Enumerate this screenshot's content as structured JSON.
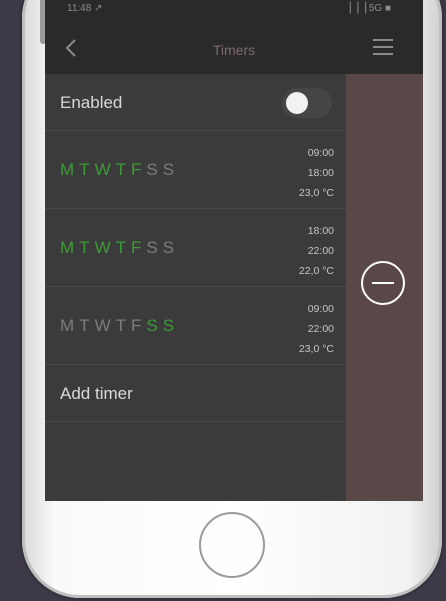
{
  "status_bar": {
    "time": "11:48 ↗",
    "signal": "▕▕▕ 5G ■"
  },
  "navbar": {
    "back_icon": "chevron-left-icon",
    "title": "Timers",
    "menu_icon": "hamburger-menu-icon"
  },
  "enabled_row": {
    "label": "Enabled",
    "toggle_on": false
  },
  "timers": [
    {
      "days": [
        {
          "letter": "M",
          "active": true
        },
        {
          "letter": "T",
          "active": true
        },
        {
          "letter": "W",
          "active": true
        },
        {
          "letter": "T",
          "active": true
        },
        {
          "letter": "F",
          "active": true
        },
        {
          "letter": "S",
          "active": false
        },
        {
          "letter": "S",
          "active": false
        }
      ],
      "start": "09:00",
      "end": "18:00",
      "temperature": "23,0 °C"
    },
    {
      "days": [
        {
          "letter": "M",
          "active": true
        },
        {
          "letter": "T",
          "active": true
        },
        {
          "letter": "W",
          "active": true
        },
        {
          "letter": "T",
          "active": true
        },
        {
          "letter": "F",
          "active": true
        },
        {
          "letter": "S",
          "active": false
        },
        {
          "letter": "S",
          "active": false
        }
      ],
      "start": "18:00",
      "end": "22:00",
      "temperature": "22,0 °C"
    },
    {
      "days": [
        {
          "letter": "M",
          "active": false
        },
        {
          "letter": "T",
          "active": false
        },
        {
          "letter": "W",
          "active": false
        },
        {
          "letter": "T",
          "active": false
        },
        {
          "letter": "F",
          "active": false
        },
        {
          "letter": "S",
          "active": true
        },
        {
          "letter": "S",
          "active": true
        }
      ],
      "start": "09:00",
      "end": "22:00",
      "temperature": "23,0 °C"
    }
  ],
  "add_row": {
    "label": "Add timer"
  },
  "action_panel": {
    "remove_icon": "remove-circle-icon"
  },
  "colors": {
    "active_day": "#3d9b37",
    "inactive_day": "#7c7c7c",
    "action_panel": "#5a4848",
    "nav_title": "#7c6a6e"
  }
}
